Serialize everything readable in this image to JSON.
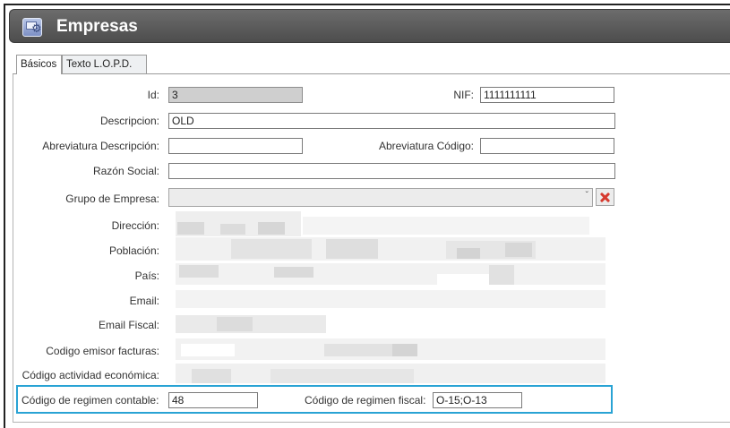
{
  "window": {
    "title": "Empresas",
    "icon": "company-settings-icon"
  },
  "tabs": [
    {
      "label": "Básicos",
      "active": true
    },
    {
      "label": "Texto L.O.P.D.",
      "active": false
    }
  ],
  "form": {
    "id": {
      "label": "Id:",
      "value": "3"
    },
    "nif": {
      "label": "NIF:",
      "value": "1111111111"
    },
    "descripcion": {
      "label": "Descripcion:",
      "value": "OLD"
    },
    "abreviatura_descripcion": {
      "label": "Abreviatura Descripción:",
      "value": ""
    },
    "abreviatura_codigo": {
      "label": "Abreviatura Código:",
      "value": ""
    },
    "razon_social": {
      "label": "Razón Social:",
      "value": ""
    },
    "grupo_empresa": {
      "label": "Grupo de Empresa:",
      "value": ""
    },
    "direccion": {
      "label": "Dirección:"
    },
    "poblacion": {
      "label": "Población:"
    },
    "pais": {
      "label": "País:"
    },
    "email": {
      "label": "Email:"
    },
    "email_fiscal": {
      "label": "Email Fiscal:"
    },
    "codigo_emisor": {
      "label": "Codigo emisor facturas:"
    },
    "codigo_actividad": {
      "label": "Código actividad económica:"
    },
    "regimen_contable": {
      "label": "Código de regimen contable:",
      "value": "48"
    },
    "regimen_fiscal": {
      "label": "Código de regimen fiscal:",
      "value": "O-15;O-13"
    }
  },
  "colors": {
    "highlight_border": "#29a3d4",
    "title_bar": "#5a5a5a",
    "clear_icon": "#d63a2f"
  }
}
